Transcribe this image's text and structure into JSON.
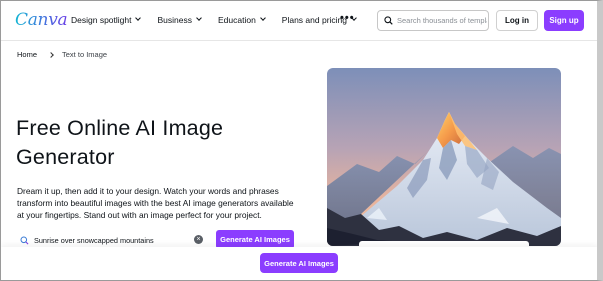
{
  "header": {
    "logo": "Canva",
    "nav": [
      {
        "label": "Design spotlight"
      },
      {
        "label": "Business"
      },
      {
        "label": "Education"
      },
      {
        "label": "Plans and pricing"
      }
    ],
    "more_icon": "more-horizontal-icon",
    "search_placeholder": "Search thousands of templates",
    "login_label": "Log in",
    "signup_label": "Sign up"
  },
  "breadcrumb": {
    "home": "Home",
    "current": "Text to Image"
  },
  "hero": {
    "title_line1": "Free Online AI Image",
    "title_line2": "Generator",
    "description": "Dream it up, then add it to your design. Watch your words and phrases transform into beautiful images with the best AI image generators available at your fingertips. Stand out with an image perfect for your project.",
    "prompt_value": "Sunrise over snowcapped mountains",
    "generate_label": "Generate AI Images",
    "image_alt": "Snowcapped mountain peak lit by sunrise"
  },
  "bottom_bar": {
    "generate_label": "Generate AI Images"
  },
  "colors": {
    "accent": "#8b3dff",
    "text": "#0e1318"
  }
}
